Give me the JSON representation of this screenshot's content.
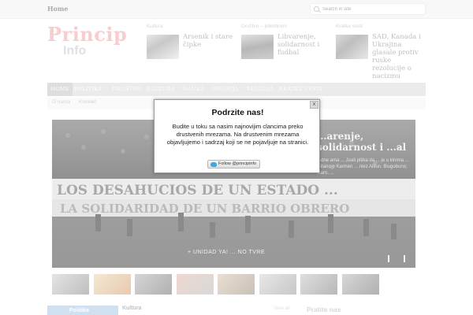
{
  "topbar": {
    "home": "Home",
    "search_placeholder": "Search in site"
  },
  "logo": {
    "title": "Princip",
    "subtitle": "Info"
  },
  "header_news": [
    {
      "category": "Kultura",
      "title": "Arsenik i stare čipke"
    },
    {
      "category": "Društvo – jebmbomi",
      "title": "Libvarenje, solidarnost i fudbal"
    },
    {
      "category": "Kratke vesti",
      "title": "SAD, Kanada i Ukrajina glasale protiv ruske rezolucije o nacizmu"
    }
  ],
  "nav": {
    "items": [
      "HOME",
      "POLITIKA",
      "DRUŠTVO",
      "KULTURA",
      "NAUKA",
      "ISTORIJA",
      "RELIGIJA",
      "KRATKE VESTI"
    ]
  },
  "subnav": {
    "items": [
      "O nama",
      "Kontakt"
    ]
  },
  "slider": {
    "title": "...arenje, solidarnost i ...al",
    "text": "...dne ama ... Joali pitika da ... je u kinima ... Gitano o Karmen ... niez Altiun. Biugobuno; staro, ...",
    "caption": "+ UNIDAD YA! ... NO TVRE",
    "banner_line1": "LOS DESAHUCIOS DE UN ESTADO ...",
    "banner_line2": "LA SOLIDARIDAD DE UN BARRIO OBRERO"
  },
  "thumbnails": [
    "thumb-1",
    "thumb-2",
    "thumb-3",
    "thumb-4",
    "thumb-5",
    "thumb-6",
    "thumb-7",
    "thumb-8"
  ],
  "bottom": {
    "politika": "Politika",
    "kultura": "Kultura",
    "view_all": "View all",
    "pratite": "Pratite nas"
  },
  "modal": {
    "title": "Podrzite nas!",
    "body": "Budite u toku sa nasim najnovijim clancima preko drustvenih mrezama. Na drustvenim mrezama objavljujemo i sadrzaj koji se ne pojavljuje na stranici.",
    "close": "x",
    "follow_label": "Follow @principinfo"
  },
  "colors": {
    "accent_blue": "#a9c7e6",
    "nav_gray": "#dadada",
    "logo_red": "#f2a4a4",
    "twitter_blue": "#3ba8e0"
  }
}
